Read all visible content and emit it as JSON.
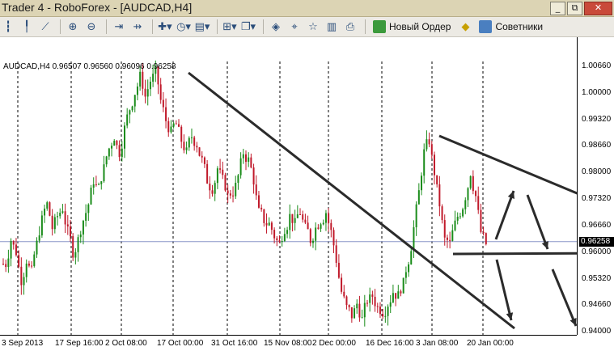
{
  "window": {
    "title": "Trader 4 - RoboForex - [AUDCAD,H4]",
    "buttons": [
      "_",
      "⧉",
      "✕"
    ]
  },
  "toolbar": {
    "new_order_label": "Новый Ордер",
    "advisors_label": "Советники"
  },
  "chart": {
    "info_line": "AUDCAD,H4  0.96507 0.96560 0.96096 0.96258",
    "current_price": "0.96258",
    "y_labels": [
      "1.00660",
      "1.00000",
      "0.99320",
      "0.98660",
      "0.98000",
      "0.97320",
      "0.96660",
      "0.96258",
      "0.96000",
      "0.95320",
      "0.94660",
      "0.94000"
    ],
    "x_labels": [
      "3 Sep 2013",
      "17 Sep 16:00",
      "2 Oct 08:00",
      "17 Oct 00:00",
      "31 Oct 16:00",
      "15 Nov 08:00",
      "2 Dec 00:00",
      "16 Dec 16:00",
      "3 Jan 08:00",
      "20 Jan 00:00"
    ],
    "colors": {
      "bull": "#1a8c1a",
      "bear": "#c0192a",
      "trendline": "#2b2b2b",
      "grid": "#000000",
      "priceline": "#8a96c8"
    }
  },
  "chart_data": {
    "type": "candlestick",
    "symbol": "AUDCAD",
    "timeframe": "H4",
    "ohlc_last": {
      "open": 0.96507,
      "high": 0.9656,
      "low": 0.96096,
      "close": 0.96258
    },
    "price_path": [
      0.957,
      0.963,
      0.96,
      0.953,
      0.958,
      0.955,
      0.962,
      0.968,
      0.972,
      0.966,
      0.969,
      0.971,
      0.965,
      0.96,
      0.963,
      0.968,
      0.972,
      0.978,
      0.976,
      0.981,
      0.986,
      0.989,
      0.985,
      0.991,
      0.996,
      1.0,
      1.004,
      0.999,
      1.003,
      1.005,
      0.998,
      0.993,
      0.99,
      0.992,
      0.988,
      0.985,
      0.989,
      0.987,
      0.983,
      0.978,
      0.976,
      0.981,
      0.978,
      0.974,
      0.975,
      0.979,
      0.985,
      0.983,
      0.978,
      0.97,
      0.968,
      0.967,
      0.964,
      0.962,
      0.966,
      0.969,
      0.967,
      0.97,
      0.966,
      0.963,
      0.966,
      0.968,
      0.97,
      0.965,
      0.958,
      0.95,
      0.946,
      0.944,
      0.947,
      0.943,
      0.948,
      0.949,
      0.946,
      0.945,
      0.947,
      0.95,
      0.949,
      0.952,
      0.958,
      0.966,
      0.975,
      0.985,
      0.988,
      0.98,
      0.972,
      0.963,
      0.962,
      0.967,
      0.97,
      0.974,
      0.98,
      0.974,
      0.965,
      0.962
    ],
    "ylim": [
      0.94,
      1.0066
    ],
    "grid": "vertical dashed",
    "trendlines": [
      {
        "from": [
          "17 Oct 00:00",
          1.0046
        ],
        "to": [
          "20 Jan 00:00",
          0.94
        ]
      },
      {
        "from": [
          "3 Jan 08:00",
          0.9874
        ],
        "to": [
          "20 Jan 00:00+",
          0.9665
        ]
      },
      {
        "from": [
          "3 Jan 08:00",
          0.962
        ],
        "to": [
          "20 Jan 00:00+",
          0.962
        ]
      }
    ]
  }
}
